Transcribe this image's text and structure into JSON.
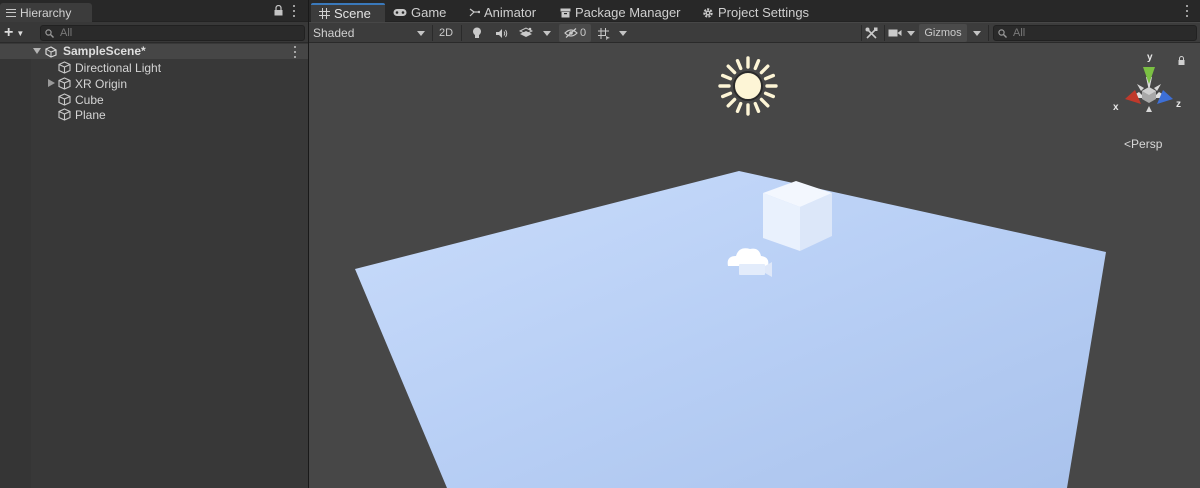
{
  "hierarchy": {
    "tab_label": "Hierarchy",
    "add_label": "+",
    "search_placeholder": "All",
    "scene_name": "SampleScene*",
    "objects": [
      {
        "name": "Directional Light",
        "expandable": false
      },
      {
        "name": "XR Origin",
        "expandable": true
      },
      {
        "name": "Cube",
        "expandable": false
      },
      {
        "name": "Plane",
        "expandable": false
      }
    ]
  },
  "tabs": [
    {
      "label": "Scene",
      "icon": "grid-icon",
      "active": true
    },
    {
      "label": "Game",
      "icon": "gamepad-icon",
      "active": false
    },
    {
      "label": "Animator",
      "icon": "animator-icon",
      "active": false
    },
    {
      "label": "Package Manager",
      "icon": "package-icon",
      "active": false
    },
    {
      "label": "Project Settings",
      "icon": "gear-icon",
      "active": false
    }
  ],
  "scene_toolbar": {
    "draw_mode": "Shaded",
    "mode_2d": "2D",
    "hidden_count": "0",
    "gizmos_label": "Gizmos",
    "search_placeholder": "All"
  },
  "viewport": {
    "projection_label": "Persp",
    "axes": {
      "x": "x",
      "y": "y",
      "z": "z"
    },
    "colors": {
      "background": "#474747",
      "plane": "#b8cff5",
      "x_axis": "#c0392b",
      "y_axis": "#7bc043",
      "z_axis": "#3d6fd6"
    }
  }
}
